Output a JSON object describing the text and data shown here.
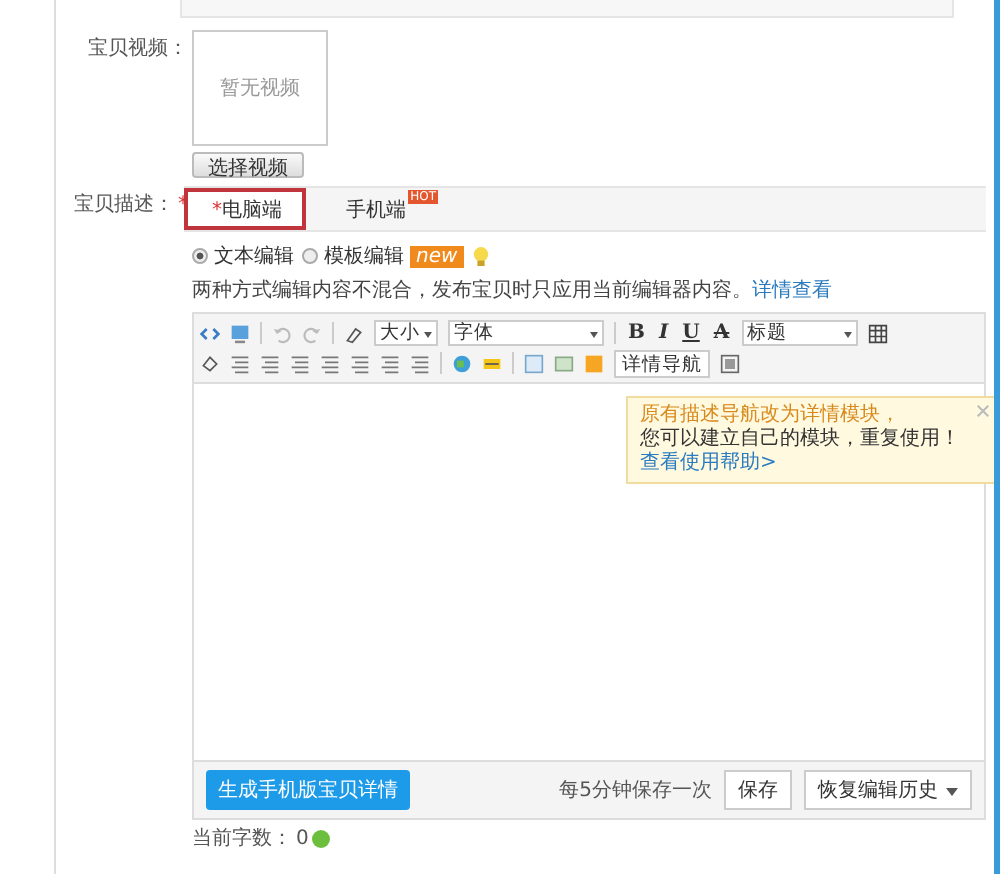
{
  "video": {
    "label": "宝贝视频：",
    "empty_text": "暂无视频",
    "button": "选择视频"
  },
  "description": {
    "label": "宝贝描述：",
    "required_mark": "*",
    "tabs": [
      {
        "mark": "*",
        "label": "电脑端",
        "selected": true
      },
      {
        "label": "手机端",
        "badge": "HOT",
        "selected": false
      }
    ],
    "modes": [
      {
        "label": "文本编辑",
        "selected": true
      },
      {
        "label": "模板编辑",
        "badge": "new",
        "selected": false
      }
    ],
    "hint": "两种方式编辑内容不混合，发布宝贝时只应用当前编辑器内容。",
    "hint_link": "详情查看"
  },
  "editor": {
    "size_select": "大小",
    "font_select": "字体",
    "bold": "B",
    "italic": "I",
    "underline": "U",
    "strike": "A",
    "heading_select": "标题",
    "nav_button": "详情导航",
    "tooltip": {
      "line_1": "原有描述导航改为详情模块，",
      "line_2": "您可以建立自己的模块，重复使用！",
      "link": "查看使用帮助>"
    },
    "generate_button": "生成手机版宝贝详情",
    "autosave": "每5分钟保存一次",
    "save_button": "保存",
    "history_button": "恢复编辑历史"
  },
  "word_count": {
    "label": "当前字数：",
    "value": "0"
  }
}
